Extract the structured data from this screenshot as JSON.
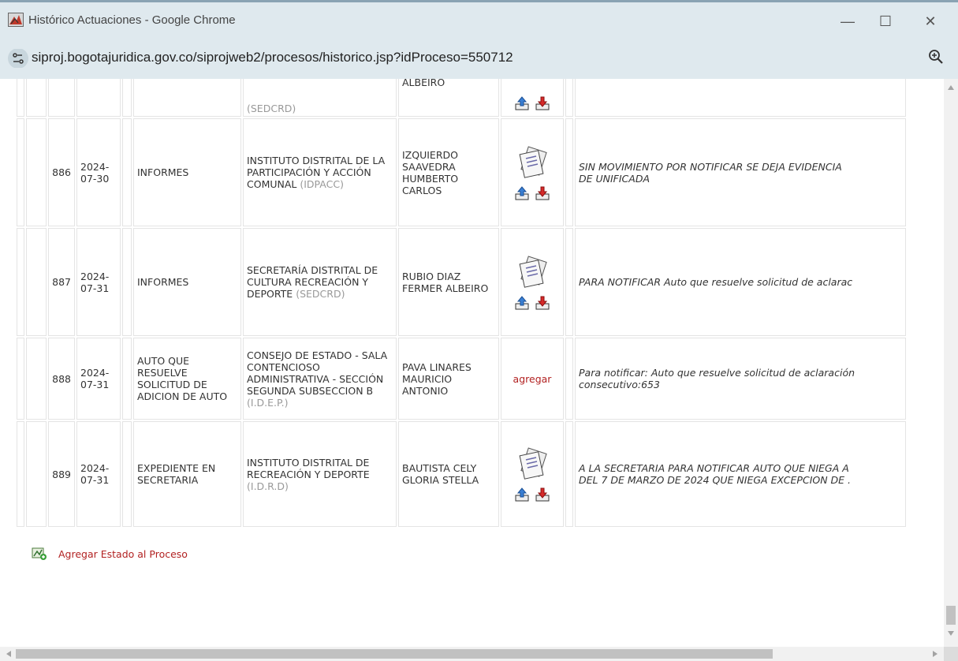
{
  "window": {
    "title": "Histórico Actuaciones - Google Chrome",
    "minimize": "—",
    "maximize": "☐",
    "close": "✕"
  },
  "address": {
    "url": "siproj.bogotajuridica.gov.co/siprojweb2/procesos/historico.jsp?idProceso=550712"
  },
  "table": {
    "partial_row": {
      "entity_abbr": "(SEDCRD)",
      "person": "ALBEIRO"
    },
    "rows": [
      {
        "num": "886",
        "date": "2024-07-30",
        "type": "INFORMES",
        "entity": "INSTITUTO DISTRITAL DE LA PARTICIPACIÓN Y ACCIÓN COMUNAL",
        "entity_abbr": "(IDPACC)",
        "person": "IZQUIERDO SAAVEDRA HUMBERTO CARLOS",
        "obs_line1": "SIN MOVIMIENTO POR NOTIFICAR SE DEJA EVIDENCIA",
        "obs_line2": "DE UNIFICADA"
      },
      {
        "num": "887",
        "date": "2024-07-31",
        "type": "INFORMES",
        "entity": "SECRETARÍA DISTRITAL DE CULTURA RECREACIÓN Y DEPORTE",
        "entity_abbr": "(SEDCRD)",
        "person": "RUBIO DIAZ FERMER ALBEIRO",
        "obs_line1": "PARA NOTIFICAR Auto que resuelve solicitud de aclarac",
        "obs_line2": ""
      },
      {
        "num": "888",
        "date": "2024-07-31",
        "type": "AUTO QUE RESUELVE SOLICITUD DE ADICION DE AUTO",
        "entity": "CONSEJO DE ESTADO - SALA CONTENCIOSO ADMINISTRATIVA - SECCIÓN SEGUNDA SUBSECCION B",
        "entity_abbr": "(I.D.E.P.)",
        "person": "PAVA LINARES MAURICIO ANTONIO",
        "add_link": "agregar",
        "obs_line1": "Para notificar: Auto que resuelve solicitud de aclaración",
        "obs_line2": "consecutivo:653"
      },
      {
        "num": "889",
        "date": "2024-07-31",
        "type": "EXPEDIENTE EN SECRETARIA",
        "entity": "INSTITUTO DISTRITAL DE RECREACIÓN Y DEPORTE",
        "entity_abbr": "(I.D.R.D)",
        "person": "BAUTISTA CELY GLORIA STELLA",
        "obs_line1": "A LA SECRETARIA PARA NOTIFICAR AUTO QUE NIEGA A",
        "obs_line2": "DEL 7 DE MARZO DE 2024 QUE NIEGA EXCEPCION DE ."
      }
    ]
  },
  "footer": {
    "add_state_label": "Agregar Estado al Proceso"
  }
}
